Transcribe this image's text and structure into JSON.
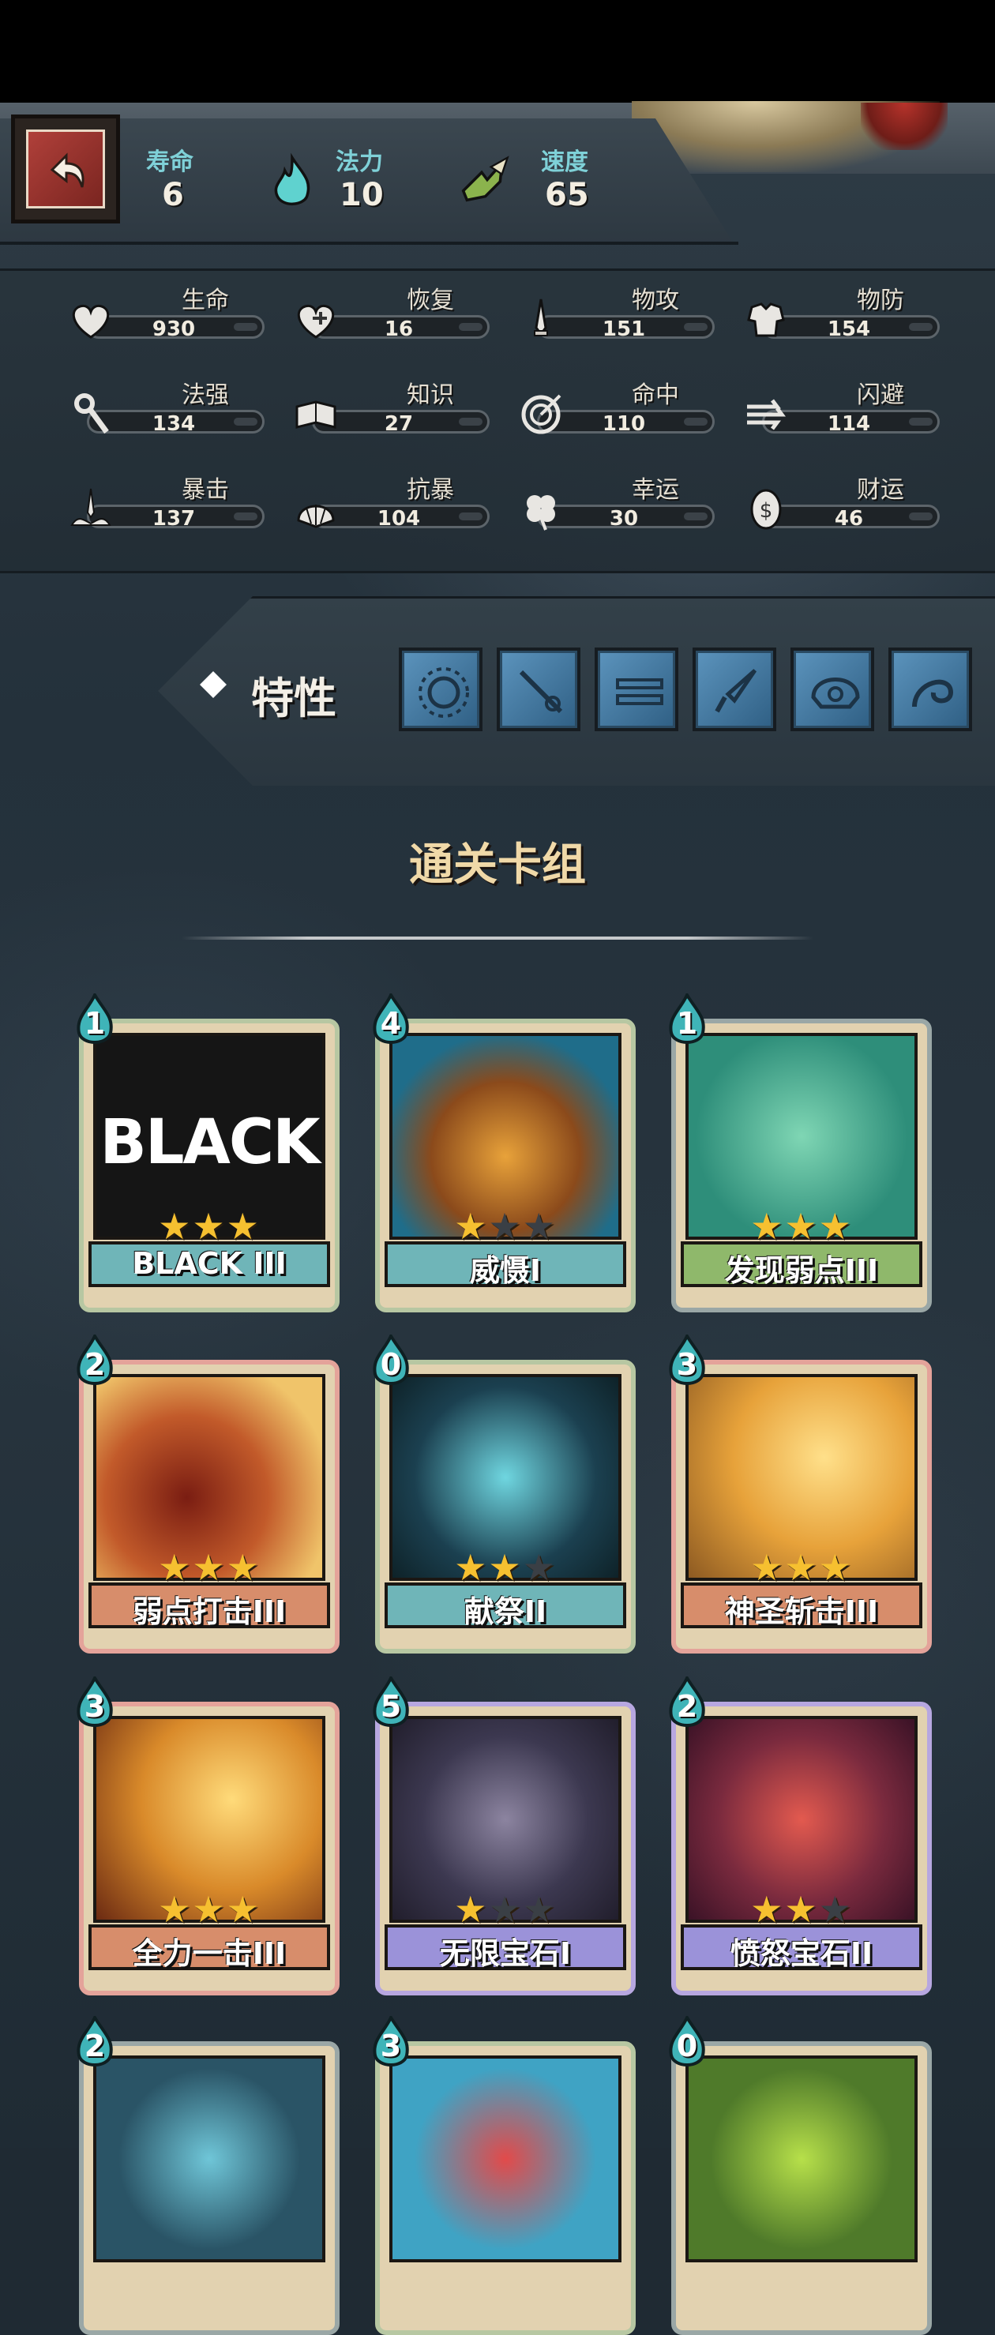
{
  "resources": [
    {
      "label": "寿命",
      "value": "6",
      "icon": "hourglass-icon"
    },
    {
      "label": "法力",
      "value": "10",
      "icon": "mana-flame-icon"
    },
    {
      "label": "速度",
      "value": "65",
      "icon": "winged-boot-icon"
    }
  ],
  "stats": [
    {
      "label": "生命",
      "value": "930",
      "icon": "heart-icon"
    },
    {
      "label": "恢复",
      "value": "16",
      "icon": "heal-heart-icon"
    },
    {
      "label": "物攻",
      "value": "151",
      "icon": "sword-icon"
    },
    {
      "label": "物防",
      "value": "154",
      "icon": "armor-icon"
    },
    {
      "label": "法强",
      "value": "134",
      "icon": "staff-icon"
    },
    {
      "label": "知识",
      "value": "27",
      "icon": "book-icon"
    },
    {
      "label": "命中",
      "value": "110",
      "icon": "target-icon"
    },
    {
      "label": "闪避",
      "value": "114",
      "icon": "dodge-arrows-icon"
    },
    {
      "label": "暴击",
      "value": "137",
      "icon": "crit-sword-icon"
    },
    {
      "label": "抗暴",
      "value": "104",
      "icon": "shell-shield-icon"
    },
    {
      "label": "幸运",
      "value": "30",
      "icon": "clover-icon"
    },
    {
      "label": "财运",
      "value": "46",
      "icon": "coin-icon"
    }
  ],
  "traits": {
    "label": "特性",
    "items": [
      "sun-trait-icon",
      "wand-trait-icon",
      "bars-trait-icon",
      "dagger-trait-icon",
      "helmet-trait-icon",
      "swirl-trait-icon"
    ]
  },
  "deck": {
    "title": "通关卡组",
    "cards": [
      {
        "name": "BLACK III",
        "cost": "1",
        "stars": 3,
        "banner": "#6fb5b8",
        "frame": "#b7c7a2",
        "art": "black"
      },
      {
        "name": "威慑I",
        "cost": "4",
        "stars": 1,
        "banner": "#6fb5b8",
        "frame": "#b7c7a2",
        "art": "fist"
      },
      {
        "name": "发现弱点III",
        "cost": "1",
        "stars": 3,
        "banner": "#8fb86b",
        "frame": "#9aa7a6",
        "art": "weak"
      },
      {
        "name": "弱点打击III",
        "cost": "2",
        "stars": 3,
        "banner": "#d78d6b",
        "frame": "#e4a39a",
        "art": "strike"
      },
      {
        "name": "献祭II",
        "cost": "0",
        "stars": 2,
        "banner": "#6fb5b8",
        "frame": "#b7c7a2",
        "art": "sacrifice"
      },
      {
        "name": "神圣斩击III",
        "cost": "3",
        "stars": 3,
        "banner": "#d78d6b",
        "frame": "#e4a39a",
        "art": "holy"
      },
      {
        "name": "全力一击III",
        "cost": "3",
        "stars": 3,
        "banner": "#d78d6b",
        "frame": "#e4a39a",
        "art": "fullforce"
      },
      {
        "name": "无限宝石I",
        "cost": "5",
        "stars": 1,
        "banner": "#9b92d9",
        "frame": "#b7a7e0",
        "art": "gem"
      },
      {
        "name": "愤怒宝石II",
        "cost": "2",
        "stars": 2,
        "banner": "#9b92d9",
        "frame": "#b7a7e0",
        "art": "rage"
      },
      {
        "name": "",
        "cost": "2",
        "stars": 0,
        "banner": "#6fb5b8",
        "frame": "#9aa7a6",
        "art": "rock"
      },
      {
        "name": "",
        "cost": "3",
        "stars": 0,
        "banner": "#d78d6b",
        "frame": "#b7c7a2",
        "art": "ruby"
      },
      {
        "name": "",
        "cost": "0",
        "stars": 0,
        "banner": "#8fb86b",
        "frame": "#9aa7a6",
        "art": "green"
      }
    ]
  },
  "colors": {
    "accent_teal": "#7fd1d8",
    "star_gold": "#f6c030",
    "title_gold": "#f0d9a8"
  }
}
